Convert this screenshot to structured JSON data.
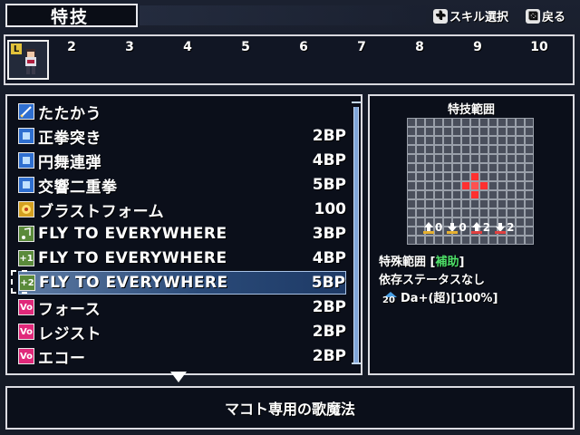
{
  "header": {
    "title": "特技",
    "hint_skill_icon": "✚",
    "hint_skill_label": "スキル選択",
    "hint_back_icon": "⊠",
    "hint_back_label": "戻る"
  },
  "party": {
    "badge": "L",
    "slots": [
      "2",
      "3",
      "4",
      "5",
      "6",
      "7",
      "8",
      "9",
      "10"
    ]
  },
  "skills": [
    {
      "icon": "sword",
      "icon_label": "",
      "name": "たたかう",
      "cost": ""
    },
    {
      "icon": "square",
      "icon_label": "",
      "name": "正拳突き",
      "cost": "2BP"
    },
    {
      "icon": "square",
      "icon_label": "",
      "name": "円舞連弾",
      "cost": "4BP"
    },
    {
      "icon": "square",
      "icon_label": "",
      "name": "交響二重拳",
      "cost": "5BP"
    },
    {
      "icon": "burst",
      "icon_label": "",
      "name": "ブラストフォーム",
      "cost": "100"
    },
    {
      "icon": "note",
      "icon_label": "",
      "name": "FLY TO EVERYWHERE",
      "cost": "3BP"
    },
    {
      "icon": "note-plus",
      "icon_label": "+1",
      "name": "FLY TO EVERYWHERE",
      "cost": "4BP"
    },
    {
      "icon": "note-plus",
      "icon_label": "+2",
      "name": "FLY TO EVERYWHERE",
      "cost": "5BP"
    },
    {
      "icon": "vo",
      "icon_label": "Vo",
      "name": "フォース",
      "cost": "2BP"
    },
    {
      "icon": "vo",
      "icon_label": "Vo",
      "name": "レジスト",
      "cost": "2BP"
    },
    {
      "icon": "vo",
      "icon_label": "Vo",
      "name": "エコー",
      "cost": "2BP"
    }
  ],
  "selected_index": 7,
  "info": {
    "range_title": "特技範囲",
    "stats": [
      {
        "icon": "up-arrow-icon",
        "value": "0"
      },
      {
        "icon": "down-arrow-icon",
        "value": "0"
      },
      {
        "icon": "up-arrow-icon",
        "value": "2"
      },
      {
        "icon": "down-arrow-icon",
        "value": "2"
      }
    ],
    "special_prefix": "特殊範囲 [",
    "special_value": "補助",
    "special_suffix": "]",
    "dependency": "依存ステータスなし",
    "damage_icon": "20",
    "damage": "Da+(超)[100%]"
  },
  "description": "マコト専用の歌魔法",
  "colors": {
    "accent_selected": "#2a4a78",
    "vo_icon": "#e0287a",
    "note_icon": "#5a8a3a",
    "square_icon": "#2f6fd0",
    "burst_icon": "#d4a020",
    "support_green": "#4ee06a"
  }
}
